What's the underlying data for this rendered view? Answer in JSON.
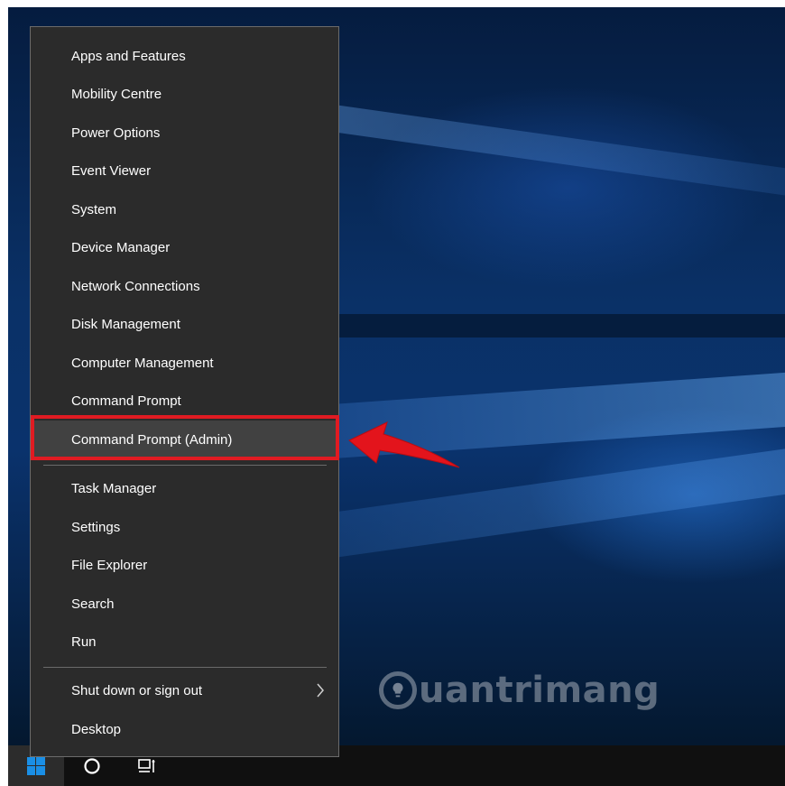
{
  "menu": {
    "items": [
      {
        "label": "Apps and Features"
      },
      {
        "label": "Mobility Centre"
      },
      {
        "label": "Power Options"
      },
      {
        "label": "Event Viewer"
      },
      {
        "label": "System"
      },
      {
        "label": "Device Manager"
      },
      {
        "label": "Network Connections"
      },
      {
        "label": "Disk Management"
      },
      {
        "label": "Computer Management"
      },
      {
        "label": "Command Prompt"
      },
      {
        "label": "Command Prompt (Admin)"
      },
      {
        "label": "Task Manager"
      },
      {
        "label": "Settings"
      },
      {
        "label": "File Explorer"
      },
      {
        "label": "Search"
      },
      {
        "label": "Run"
      },
      {
        "label": "Shut down or sign out"
      },
      {
        "label": "Desktop"
      }
    ],
    "highlighted_item": "Command Prompt (Admin)"
  },
  "watermark": {
    "text": "uantrimang"
  },
  "colors": {
    "menu_background": "#2b2b2b",
    "highlight": "#414141",
    "annotation_red": "#e01b22",
    "start_button_blue": "#1a8fe6"
  },
  "icons": [
    "windows-logo-icon",
    "cortana-circle-icon",
    "task-view-icon",
    "chevron-right-icon",
    "red-arrow-icon",
    "lightbulb-icon"
  ]
}
